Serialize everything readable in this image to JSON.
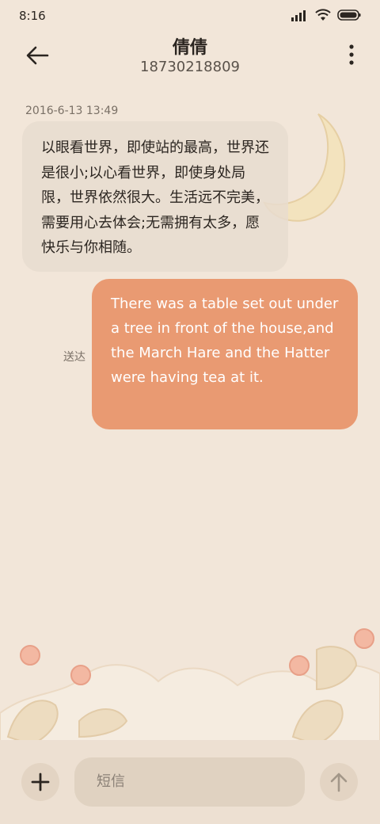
{
  "status_bar": {
    "time": "8:16"
  },
  "header": {
    "contact_name": "倩倩",
    "contact_number": "18730218809"
  },
  "conversation": {
    "timestamp": "2016-6-13 13:49",
    "incoming_message": "以眼看世界，即使站的最高，世界还是很小;以心看世界，即使身处局限，世界依然很大。生活远不完美，需要用心去体会;无需拥有太多，愿快乐与你相随。",
    "outgoing_message": "There was a table set out under a tree in front of the house,and the March Hare and the Hatter were having tea at it.",
    "delivery_status": "送达"
  },
  "composer": {
    "placeholder": "短信"
  },
  "colors": {
    "background": "#f2e6d9",
    "incoming_bubble": "#e8dccf",
    "outgoing_bubble": "#e99a72",
    "input_bar": "#ede0d2"
  },
  "icons": [
    "signal-icon",
    "wifi-icon",
    "battery-icon",
    "back-arrow-icon",
    "more-vert-icon",
    "plus-icon",
    "send-arrow-icon"
  ]
}
